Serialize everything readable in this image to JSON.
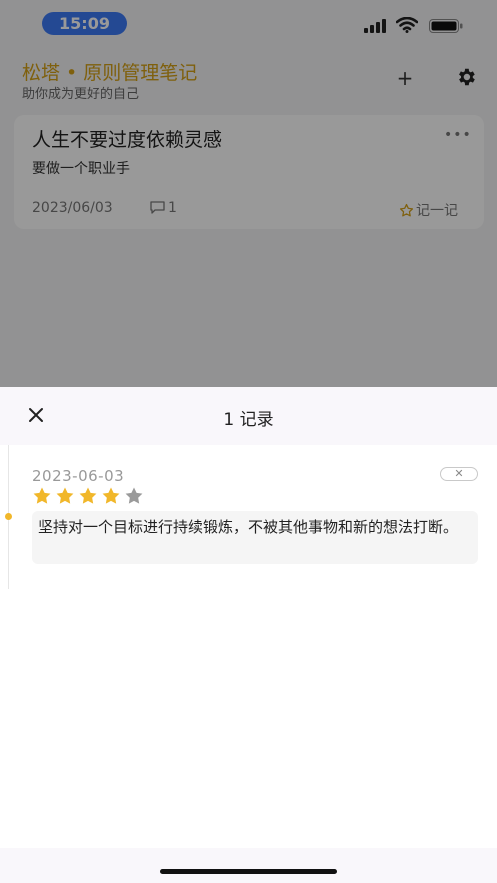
{
  "status_bar": {
    "time": "15:09",
    "signal_icon": "cellular-signal-icon",
    "wifi_icon": "wifi-icon",
    "battery_icon": "battery-icon"
  },
  "header": {
    "title": "松塔 • 原则管理笔记",
    "subtitle": "助你成为更好的自己",
    "add_label": "+",
    "add_icon": "plus-icon",
    "settings_icon": "gear-icon"
  },
  "note": {
    "title": "人生不要过度依赖灵感",
    "description": "要做一个职业手",
    "more_label": "•••",
    "date": "2023/06/03",
    "comment_count": "1",
    "record_label": "记一记"
  },
  "sheet": {
    "title": "1 记录",
    "close_icon": "close-icon",
    "entries": [
      {
        "date": "2023-06-03",
        "rating": 4,
        "rating_max": 5,
        "delete_label": "✕",
        "text": "坚持对一个目标进行持续锻炼，不被其他事物和新的想法打断。"
      }
    ]
  },
  "colors": {
    "accent_gold": "#d4a017",
    "time_pill": "#3d7bf6",
    "star_filled": "#f1b72a",
    "star_empty": "#9a9a9a"
  }
}
